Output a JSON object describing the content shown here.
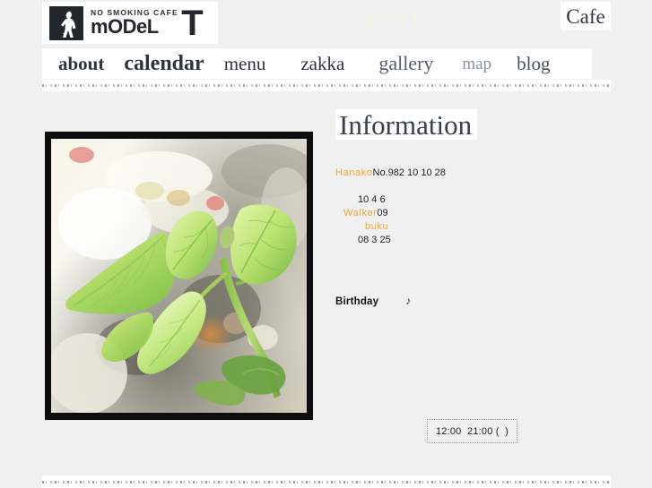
{
  "site": {
    "background_color": "#f0f0f0",
    "accent_color": "#f0a82e"
  },
  "header": {
    "logo": {
      "tagline": "NO SMOKING CAFE",
      "name": "mODeL",
      "big_letter": "T",
      "icon": "silhouette-smoking-woman-icon"
    },
    "watermark": "MODeL T",
    "cafe_plate": "Cafe"
  },
  "nav": {
    "items": [
      {
        "label": "about"
      },
      {
        "label": "calendar"
      },
      {
        "label": "menu"
      },
      {
        "label": "zakka"
      },
      {
        "label": "gallery"
      },
      {
        "label": "map"
      },
      {
        "label": "blog"
      }
    ]
  },
  "main": {
    "photo": {
      "alt": "close-up of green leaves on a plant stem",
      "name": "plant-leaves-photo"
    },
    "info": {
      "title": "Information",
      "lines": [
        {
          "text": "Hanako",
          "accent": true,
          "indent": 0
        },
        {
          "text": "No.982 10 10 28",
          "accent": false,
          "indent": 0
        },
        {
          "text": "10 4 6",
          "accent": false,
          "indent": 25
        },
        {
          "text": "Walker",
          "accent": true,
          "indent": 9
        },
        {
          "text": "09",
          "accent": false,
          "indent": 0
        },
        {
          "text": "buku",
          "accent": true,
          "indent": 33
        },
        {
          "text": "08 3 25",
          "accent": false,
          "indent": 25
        }
      ],
      "row1_accent": "Hanako",
      "row1_rest": "No.982 10 10 28",
      "row2": "10 4 6",
      "row3_accent": "Walker",
      "row3_rest": "09",
      "row4_accent": "buku",
      "row5": "08 3 25",
      "birthday_label": "Birthday",
      "birthday_note": "♪"
    },
    "hours": "12:00  21:00 (  )"
  }
}
